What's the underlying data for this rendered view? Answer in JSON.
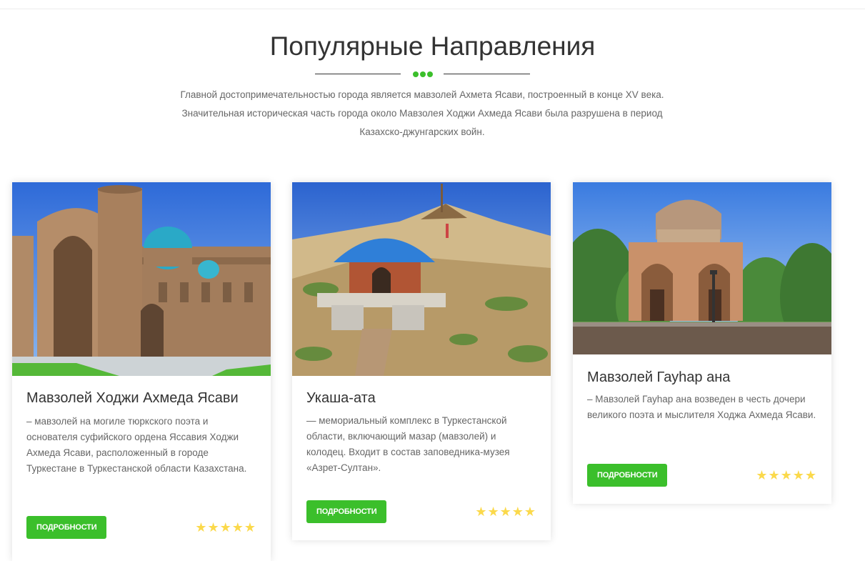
{
  "section": {
    "title": "Популярные Направления",
    "intro": "Главной достопримечательностью города является мавзолей Ахмета Ясави, построенный в конце XV века. Значительная историческая часть города около Мавзолея Ходжи Ахмеда Ясави была разрушена в период Казахско-джунгарских войн."
  },
  "colors": {
    "accent": "#3bbf2b",
    "star": "#fbd94b"
  },
  "cards": [
    {
      "title": "Мавзолей Ходжи Ахмеда Ясави",
      "description": "– мавзолей на могиле тюркского поэта и основателя суфийского ордена Яссавия Ходжи Ахмеда Ясави, расположенный в городе Туркестане в Туркестанской области Казахстана.",
      "button_label": "ПОДРОБНОСТИ",
      "rating": 5,
      "stars": "★★★★★"
    },
    {
      "title": "Укаша-ата",
      "description": "— мемориальный комплекс в Туркестанской области, включающий мазар (мавзолей) и колодец. Входит в состав заповедника-музея «Азрет-Султан».",
      "button_label": "ПОДРОБНОСТИ",
      "rating": 5,
      "stars": "★★★★★"
    },
    {
      "title": "Мавзолей Гауһар ана",
      "description": "– Мавзолей Гауһар ана возведен в честь дочери великого поэта и мыслителя Ходжа Ахмеда Ясави.",
      "button_label": "ПОДРОБНОСТИ",
      "rating": 5,
      "stars": "★★★★★"
    }
  ]
}
